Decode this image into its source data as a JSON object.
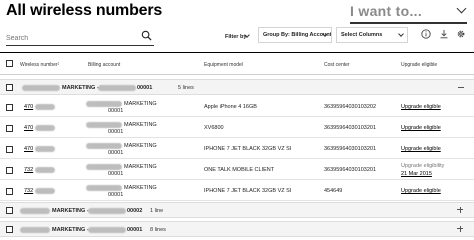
{
  "header": {
    "title": "All wireless numbers",
    "i_want_to": "I want to..."
  },
  "search": {
    "placeholder": "Search"
  },
  "toolbar": {
    "filter_by": "Filter by",
    "group_by": "Group By: Billing Account",
    "select_columns": "Select Columns"
  },
  "table": {
    "headers": {
      "wireless_number": "Wireless number",
      "billing_account": "Billing account",
      "equipment_model": "Equipment model",
      "cost_center": "Cost center",
      "upgrade_eligible": "Upgrade eligible"
    },
    "groups": [
      {
        "name": "MARKETING -",
        "suffix": "00001",
        "count": "5 lines",
        "state": "expanded"
      },
      {
        "name": "MARKETING -",
        "suffix": "00002",
        "count": "1 line",
        "state": "collapsed"
      },
      {
        "name": "MARKETING -",
        "suffix": "00001",
        "count": "8 lines",
        "state": "collapsed"
      }
    ],
    "rows": [
      {
        "number_prefix": "470",
        "account_name": "MARKETING",
        "account_suffix": "00001",
        "equipment": "Apple iPhone 4 16GB",
        "cost_center": "36395964030103202",
        "upgrade": "Upgrade eligible",
        "upgrade_date": ""
      },
      {
        "number_prefix": "470",
        "account_name": "MARKETING",
        "account_suffix": "00001",
        "equipment": "XV6800",
        "cost_center": "36395964030103201",
        "upgrade": "Upgrade eligible",
        "upgrade_date": ""
      },
      {
        "number_prefix": "470",
        "account_name": "MARKETING",
        "account_suffix": "00001",
        "equipment": "IPHONE 7 JET BLACK 32GB VZ SI",
        "cost_center": "36395964030103201",
        "upgrade": "Upgrade eligible",
        "upgrade_date": ""
      },
      {
        "number_prefix": "732",
        "account_name": "MARKETING",
        "account_suffix": "00001",
        "equipment": "ONE TALK MOBILE CLIENT",
        "cost_center": "36395964030103201",
        "upgrade": "Upgrade eligibility",
        "upgrade_date": "21 Mar 2015"
      },
      {
        "number_prefix": "732",
        "account_name": "MARKETING",
        "account_suffix": "00001",
        "equipment": "IPHONE 7 JET BLACK 32GB VZ SI",
        "cost_center": "454649",
        "upgrade": "Upgrade eligible",
        "upgrade_date": ""
      }
    ]
  },
  "icons": {
    "search": "search-icon",
    "info": "info-icon",
    "download": "download-icon",
    "settings": "gear-icon"
  }
}
